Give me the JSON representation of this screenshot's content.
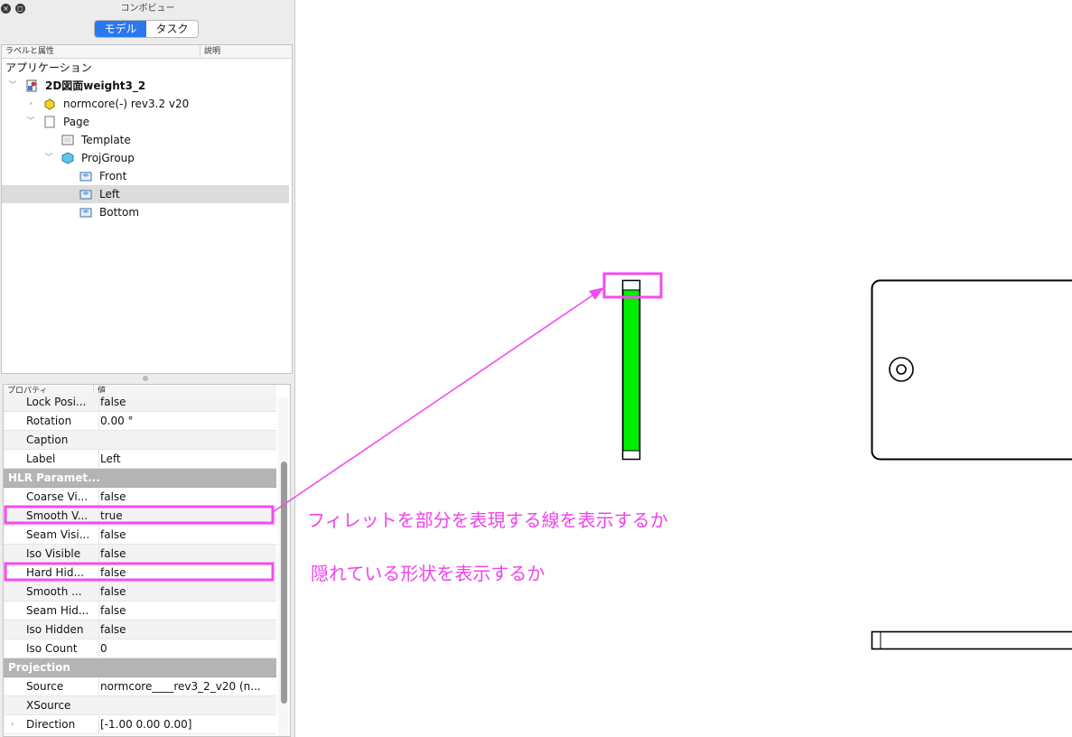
{
  "window": {
    "title": "コンボビュー",
    "close_glyph": "×",
    "float_glyph": "◻"
  },
  "tabs": [
    {
      "label": "モデル",
      "active": true
    },
    {
      "label": "タスク",
      "active": false
    }
  ],
  "tree": {
    "headers": [
      "ラベルと属性",
      "説明"
    ],
    "root_label": "アプリケーション",
    "items": [
      {
        "label": "2D図面weight3_2",
        "chevron": "﹀",
        "icon": "document-icon",
        "bold": true
      },
      {
        "label": "normcore(-) rev3.2 v20",
        "chevron": "›",
        "icon": "part-icon"
      },
      {
        "label": "Page",
        "chevron": "﹀",
        "icon": "page-icon"
      },
      {
        "label": "Template",
        "chevron": "",
        "icon": "template-icon"
      },
      {
        "label": "ProjGroup",
        "chevron": "﹀",
        "icon": "projgroup-icon"
      },
      {
        "label": "Front",
        "chevron": "",
        "icon": "view-icon"
      },
      {
        "label": "Left",
        "chevron": "",
        "icon": "view-icon",
        "selected": true
      },
      {
        "label": "Bottom",
        "chevron": "",
        "icon": "view-icon"
      }
    ]
  },
  "properties": {
    "headers": [
      "プロパティ",
      "値"
    ],
    "rows": [
      {
        "name": "Lock Posi...",
        "value": "false"
      },
      {
        "name": "Rotation",
        "value": "0.00 °"
      },
      {
        "name": "Caption",
        "value": ""
      },
      {
        "name": "Label",
        "value": "Left"
      },
      {
        "group": "HLR Paramet..."
      },
      {
        "name": "Coarse Vi...",
        "value": "false"
      },
      {
        "name": "Smooth V...",
        "value": "true"
      },
      {
        "name": "Seam Visi...",
        "value": "false"
      },
      {
        "name": "Iso Visible",
        "value": "false"
      },
      {
        "name": "Hard Hid...",
        "value": "false"
      },
      {
        "name": "Smooth ...",
        "value": "false"
      },
      {
        "name": "Seam Hid...",
        "value": "false"
      },
      {
        "name": "Iso Hidden",
        "value": "false"
      },
      {
        "name": "Iso Count",
        "value": "0"
      },
      {
        "group": "Projection"
      },
      {
        "name": "Source",
        "value": "normcore____rev3_2_v20 (n..."
      },
      {
        "name": "XSource",
        "value": ""
      },
      {
        "name": "Direction",
        "value": "[-1.00 0.00 0.00]",
        "chevron": "›"
      }
    ]
  },
  "annotations": {
    "callout_1": "フィレットを部分を表現する線を表示するか",
    "callout_2": "隠れている形状を表示するか"
  },
  "colors": {
    "highlight": "#f44bf2",
    "callout_text": "#ee44ee",
    "view_fill": "#00ee00",
    "tab_active": "#2b78ee"
  }
}
